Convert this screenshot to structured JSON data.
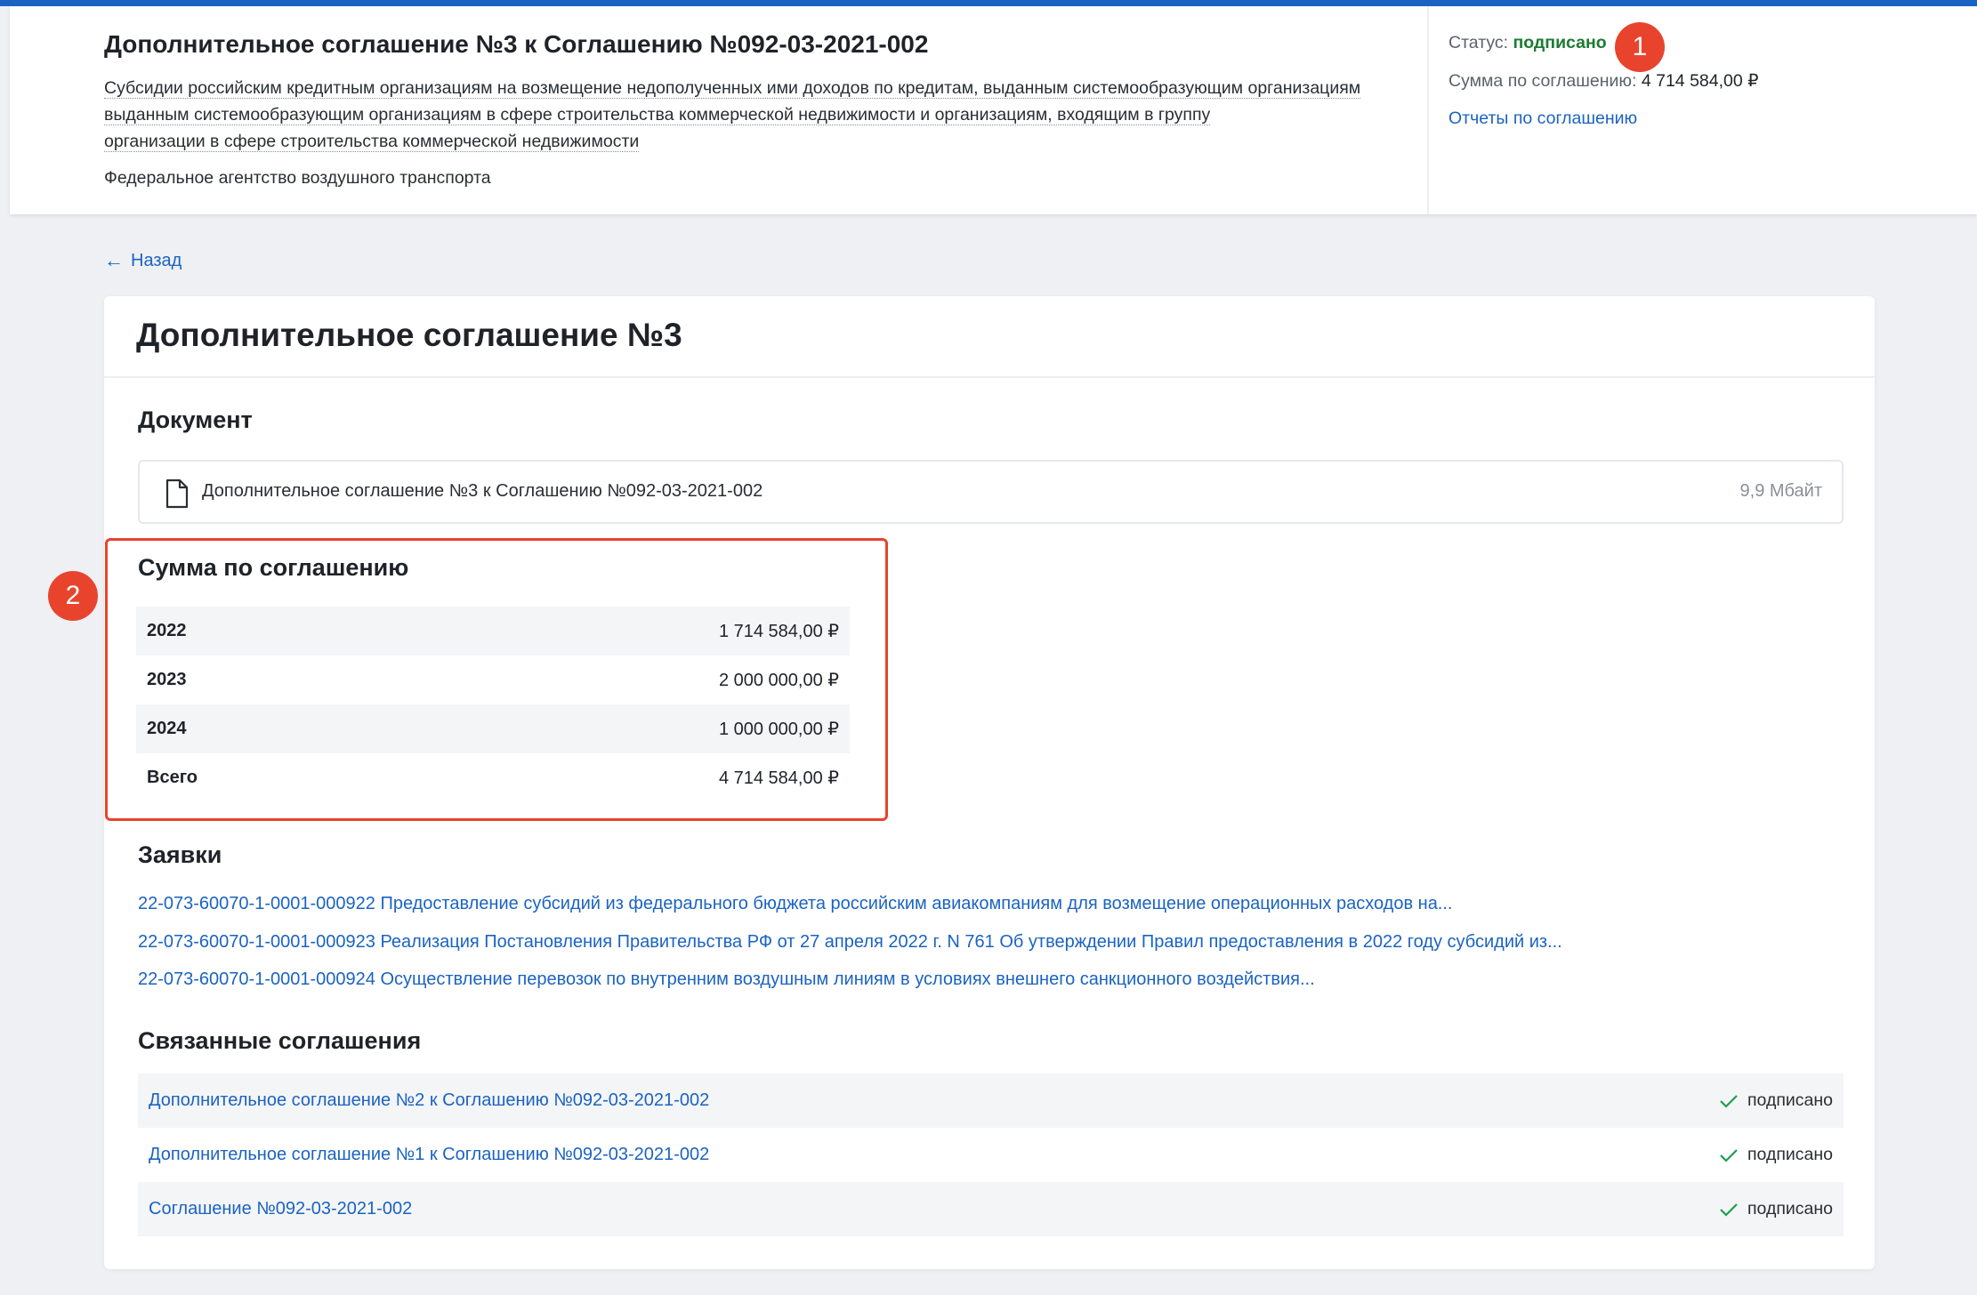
{
  "header": {
    "title": "Дополнительное соглашение №3 к Соглашению №092-03-2021-002",
    "subtitle_lines": [
      "Субсидии российским кредитным организациям на возмещение недополученных ими доходов по кредитам, выданным системообразующим организациям",
      "выданным системообразующим организациям в сфере строительства коммерческой недвижимости и организациям, входящим в группу",
      "организации в сфере строительства коммерческой недвижимости"
    ],
    "agency": "Федеральное агентство воздушного транспорта",
    "status_label": "Статус:",
    "status_value": "подписано",
    "sum_label": "Сумма по соглашению:",
    "sum_value": "4 714 584,00 ₽",
    "reports_link": "Отчеты по соглашению"
  },
  "markers": [
    "1",
    "2"
  ],
  "back_link": "Назад",
  "main": {
    "title": "Дополнительное соглашение №3",
    "document": {
      "heading": "Документ",
      "file_name": "Дополнительное соглашение №3 к Соглашению №092-03-2021-002",
      "file_size": "9,9 Мбайт"
    },
    "sum": {
      "heading": "Сумма по соглашению",
      "rows": [
        {
          "year": "2022",
          "amount": "1 714 584,00 ₽"
        },
        {
          "year": "2023",
          "amount": "2 000 000,00 ₽"
        },
        {
          "year": "2024",
          "amount": "1 000 000,00 ₽"
        },
        {
          "year": "Всего",
          "amount": "4 714 584,00 ₽"
        }
      ]
    },
    "requests": {
      "heading": "Заявки",
      "items": [
        "22-073-60070-1-0001-000922 Предоставление субсидий из федерального бюджета российским авиакомпаниям для возмещение операционных расходов на...",
        "22-073-60070-1-0001-000923 Реализация Постановления Правительства РФ от 27 апреля 2022 г. N 761 Об утверждении Правил предоставления в 2022 году субсидий из...",
        "22-073-60070-1-0001-000924 Осуществление перевозок по внутренним воздушным линиям в условиях внешнего санкционного воздействия..."
      ]
    },
    "related": {
      "heading": "Связанные соглашения",
      "items": [
        {
          "name": "Дополнительное соглашение №2 к Соглашению №092-03-2021-002",
          "status": "подписано"
        },
        {
          "name": "Дополнительное соглашение №1 к Соглашению №092-03-2021-002",
          "status": "подписано"
        },
        {
          "name": "Соглашение №092-03-2021-002",
          "status": "подписано"
        }
      ]
    }
  },
  "colors": {
    "accent": "#1b63c2",
    "marker": "#e8442d",
    "status_ok": "#1e7b34"
  },
  "icons": [
    "document-icon",
    "arrow-left-icon",
    "check-icon"
  ]
}
